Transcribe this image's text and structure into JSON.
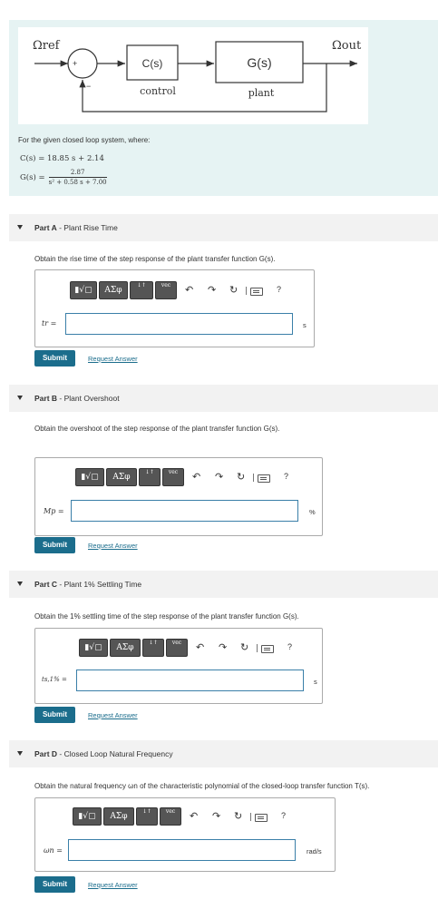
{
  "diagram": {
    "omega_ref": "Ωref",
    "omega_out": "Ωout",
    "summer_plus": "+",
    "summer_minus": "−",
    "controller_block": "C(s)",
    "controller_label": "control",
    "plant_block": "G(s)",
    "plant_label": "plant"
  },
  "intro": {
    "text": "For the given closed loop system, where:",
    "c_eq": "C(s) = 18.85 s + 2.14",
    "g_lhs": "G(s) =",
    "g_num": "2.87",
    "g_den": "s² + 0.58 s + 7.00"
  },
  "toolbar": {
    "templates": "▮√▢",
    "greek": "ΑΣφ",
    "arrows": "↓↑",
    "vec": "vec",
    "undo": "↶",
    "redo": "↷",
    "reset": "↻",
    "help": "?"
  },
  "actions": {
    "submit": "Submit",
    "request": "Request Answer"
  },
  "parts": [
    {
      "label": "Part A",
      "title": "- Plant Rise Time",
      "prompt": "Obtain the rise time of the step response of the plant transfer function G(s).",
      "variable": "tr =",
      "unit": "s",
      "value": ""
    },
    {
      "label": "Part B",
      "title": "- Plant Overshoot",
      "prompt": "Obtain the overshoot of the step response of the plant transfer function G(s).",
      "variable": "Mp =",
      "unit": "%",
      "value": ""
    },
    {
      "label": "Part C",
      "title": "- Plant 1% Settling Time",
      "prompt": "Obtain the 1% settling time of the step response of the plant transfer function G(s).",
      "variable": "ts,1% =",
      "unit": "s",
      "value": ""
    },
    {
      "label": "Part D",
      "title": "- Closed Loop Natural Frequency",
      "prompt": "Obtain the natural frequency ωn of the characteristic polynomial of the closed-loop transfer function T(s).",
      "variable": "ωn =",
      "unit": "rad/s",
      "value": ""
    }
  ]
}
